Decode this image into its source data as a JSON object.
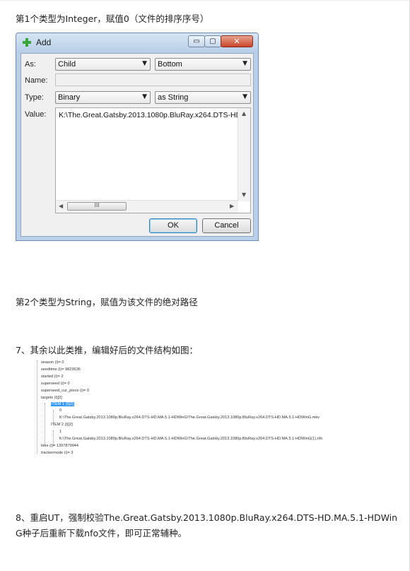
{
  "paragraphs": {
    "p1": "第1个类型为Integer，赋值0（文件的排序序号）",
    "p2": "第2个类型为String，赋值为该文件的绝对路径",
    "p3": "7、其余以此类推，编辑好后的文件结构如图：",
    "p4_line1": "8、重启UT，强制校验The.Great.Gatsby.2013.1080p.BluRay.x264.DTS-HD.MA.5.1-HDWin",
    "p4_line2": "G种子后重新下载nfo文件，即可正常辅种。"
  },
  "dialog": {
    "title": "Add",
    "window_controls": {
      "minimize": "▭",
      "maximize": "▢",
      "close": "✕"
    },
    "as_label": "As:",
    "as_value": "Child",
    "position_value": "Bottom",
    "name_label": "Name:",
    "name_value": "",
    "type_label": "Type:",
    "type_value": "Binary",
    "format_value": "as String",
    "value_label": "Value:",
    "value_text": "K:\\The.Great.Gatsby.2013.1080p.BluRay.x264.DTS-HD",
    "scroll_grip": "III",
    "ok_label": "OK",
    "cancel_label": "Cancel"
  },
  "tree": {
    "nodes": [
      "season (i)= 0",
      "seedtime (i)= 9823636",
      "started (i)= 2",
      "superseed (i)= 0",
      "superseed_cur_piece (i)= 0",
      "targets (l)[2]",
      "ITEM 1 (l)[2]",
      "0",
      "K:\\The.Great.Gatsby.2013.1080p.BluRay.x264.DTS-HD.MA.5.1-HDWinG\\The.Great.Gatsby.2013.1080p.BluRay.x264.DTS-HD.MA.5.1-HDWinG.mkv",
      "ITEM 2 (l)[2]",
      "1",
      "K:\\The.Great.Gatsby.2013.1080p.BluRay.x264.DTS-HD.MA.5.1-HDWinG\\The.Great.Gatsby.2013.1080p.BluRay.x264.DTS-HD.MA.5.1-HDWinG(1).nfo",
      "time (i)= 1397879944",
      "trackermode (i)= 3"
    ]
  },
  "colors": {
    "selection": "#3399ff",
    "add_icon": "#3aa63a"
  }
}
